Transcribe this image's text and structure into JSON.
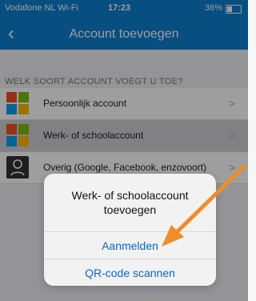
{
  "status_bar": {
    "carrier": "Vodafone NL Wi-Fi",
    "time": "17:23",
    "battery": "36%"
  },
  "nav": {
    "back_icon": "‹",
    "title": "Account toevoegen"
  },
  "section": {
    "header": "WELK SOORT ACCOUNT VOEGT U TOE?"
  },
  "rows": [
    {
      "label": "Persoonlijk account",
      "icon": "microsoft-logo-icon"
    },
    {
      "label": "Werk- of schoolaccount",
      "icon": "microsoft-logo-icon"
    },
    {
      "label": "Overig (Google, Facebook, enzovoort)",
      "icon": "person-icon"
    }
  ],
  "chevron": ">",
  "action_sheet": {
    "title": "Werk- of schoolaccount toevoegen",
    "buttons": [
      {
        "label": "Aanmelden"
      },
      {
        "label": "QR-code scannen"
      }
    ]
  },
  "colors": {
    "nav": "#0c7fd0",
    "action": "#0a66c2",
    "arrow": "#f08c2a"
  }
}
